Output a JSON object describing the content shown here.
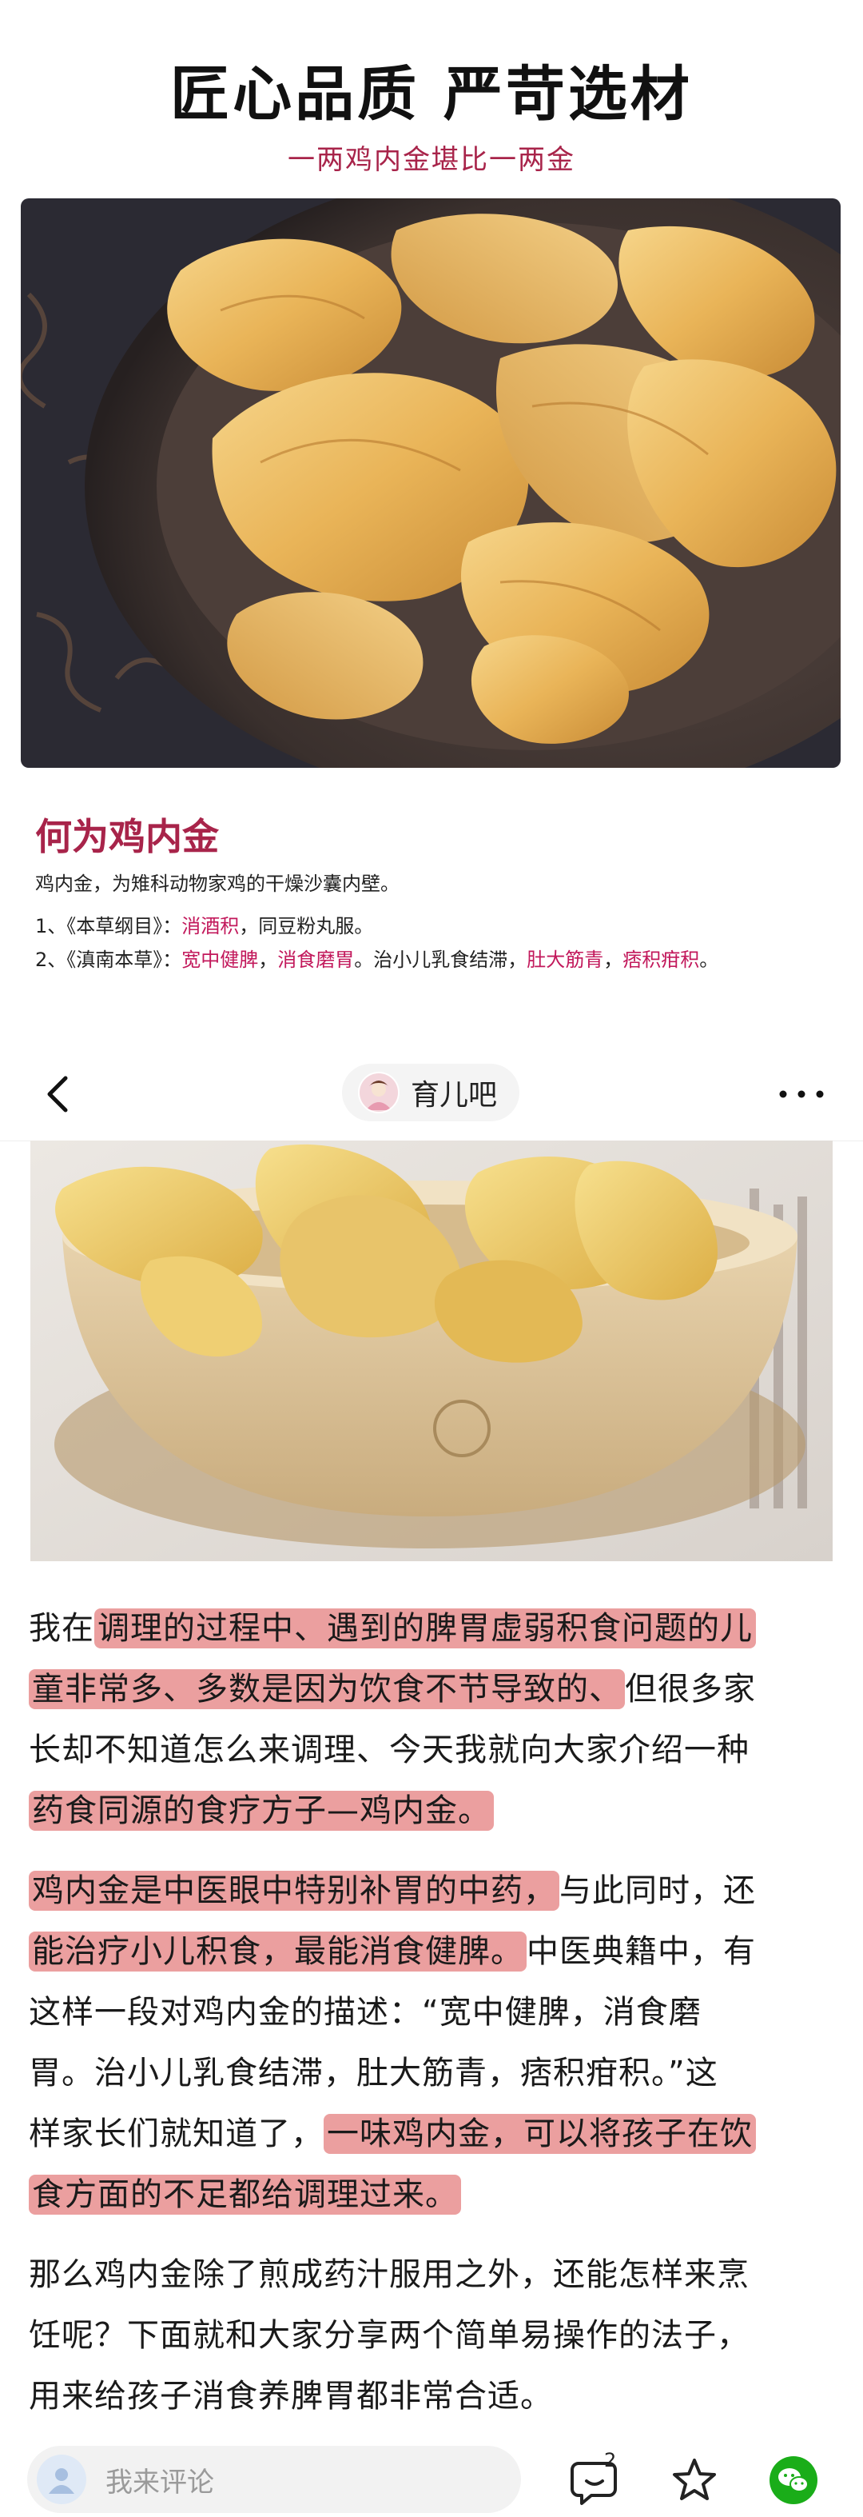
{
  "poster": {
    "title": "匠心品质 严苛选材",
    "subtitle": "一两鸡内金堪比一两金"
  },
  "info": {
    "heading": "何为鸡内金",
    "description": "鸡内金，为雉科动物家鸡的干燥沙囊内壁。",
    "item1": {
      "prefix": "1、《本草纲目》：",
      "highlight": "消酒积",
      "suffix": "，同豆粉丸服。"
    },
    "item2": {
      "prefix": "2、《滇南本草》：",
      "hl1": "宽中健脾",
      "sep1": "，",
      "hl2": "消食磨胃",
      "mid": "。治小儿乳食结滞，",
      "hl3": "肚大筋青",
      "sep2": "，",
      "hl4": "痞积疳积",
      "end": "。"
    }
  },
  "nav": {
    "community_name": "育儿吧",
    "back_icon": "chevron-left-icon",
    "more_icon": "more-horizontal-icon"
  },
  "article": {
    "p1": {
      "l1_a": "我在",
      "l1_b": "调理的过程中、遇到的脾胃虚弱积食问题的儿",
      "l2_a": "童非常多、多数是因为饮食不节导致的、",
      "l2_b": "但很多家",
      "l3": "长却不知道怎么来调理、今天我就向大家介绍一种",
      "l4": "药食同源的食疗方子—鸡内金。"
    },
    "p2": {
      "l1_a": "鸡内金是中医眼中特别补胃的中药，",
      "l1_b": "与此同时，还",
      "l2_a": "能治疗小儿积食，最能消食健脾。",
      "l2_b": "中医典籍中，有",
      "l3": "这样一段对鸡内金的描述：“宽中健脾，消食磨",
      "l4": "胃。治小儿乳食结滞，肚大筋青，痞积疳积。”这",
      "l5_a": "样家长们就知道了，",
      "l5_b": "一味鸡内金，可以将孩子在饮",
      "l6": "食方面的不足都给调理过来。"
    },
    "p3": {
      "l1": "那么鸡内金除了煎成药汁服用之外，还能怎样来烹",
      "l2": "饪呢？下面就和大家分享两个简单易操作的法子，",
      "l3": "用来给孩子消食养脾胃都非常合适。"
    }
  },
  "bottom": {
    "comment_placeholder": "我来评论",
    "comment_count": "2",
    "colors": {
      "wechat": "#1aad19",
      "highlight": "#db5050",
      "brand_red": "#a8244a"
    }
  }
}
